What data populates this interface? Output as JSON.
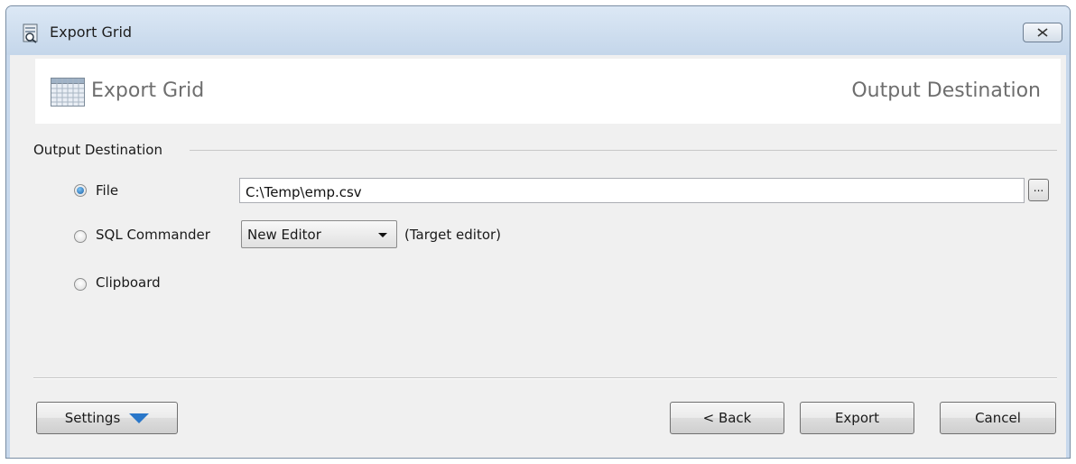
{
  "window": {
    "title": "Export Grid",
    "close_icon": "close-icon"
  },
  "banner": {
    "title": "Export Grid",
    "subtitle": "Output Destination",
    "icon": "grid-icon"
  },
  "output_group": {
    "label": "Output Destination",
    "options": [
      {
        "label": "File",
        "checked": true
      },
      {
        "label": "SQL Commander",
        "checked": false
      },
      {
        "label": "Clipboard",
        "checked": false
      }
    ],
    "file_path": "C:\\Temp\\emp.csv",
    "browse_label": "...",
    "editor_select": {
      "value": "New Editor",
      "hint": "(Target editor)"
    }
  },
  "footer": {
    "settings_label": "Settings",
    "back_label": "< Back",
    "export_label": "Export",
    "cancel_label": "Cancel"
  },
  "colors": {
    "accent": "#2a77c9",
    "titlebar": "#c4d6ea",
    "client_bg": "#f0f0f0"
  }
}
